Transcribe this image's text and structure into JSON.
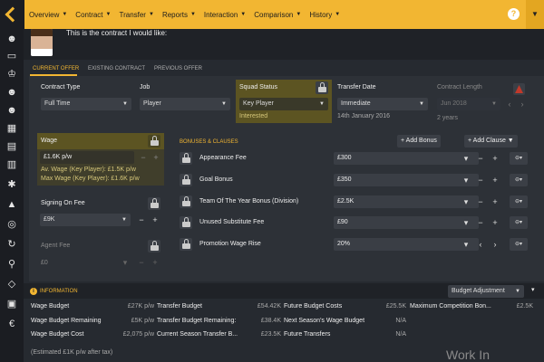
{
  "menu": [
    "Overview",
    "Contract",
    "Transfer",
    "Reports",
    "Interaction",
    "Comparison",
    "History"
  ],
  "header": {
    "quote": "This is the contract I would like:"
  },
  "tabs": [
    "CURRENT OFFER",
    "EXISTING CONTRACT",
    "PREVIOUS OFFER"
  ],
  "contract": {
    "contract_type_label": "Contract Type",
    "contract_type_value": "Full Time",
    "job_label": "Job",
    "job_value": "Player",
    "squad_status_label": "Squad Status",
    "squad_status_value": "Key Player",
    "squad_status_note": "Interested",
    "transfer_date_label": "Transfer Date",
    "transfer_date_value": "Immediate",
    "transfer_date_note": "14th January 2016",
    "contract_length_label": "Contract Length",
    "contract_length_value": "Jun 2018",
    "contract_length_note": "2 years"
  },
  "wage": {
    "label": "Wage",
    "value": "£1.6K p/w",
    "av": "Av. Wage (Key Player): £1.5K p/w",
    "max": "Max Wage (Key Player): £1.6K p/w"
  },
  "signing": {
    "label": "Signing On Fee",
    "value": "£9K"
  },
  "agent": {
    "label": "Agent Fee",
    "value": "£0"
  },
  "bonuses": {
    "title": "BONUSES & CLAUSES",
    "add_bonus": "Add Bonus",
    "add_clause": "Add Clause",
    "rows": [
      {
        "name": "Appearance Fee",
        "value": "£300"
      },
      {
        "name": "Goal Bonus",
        "value": "£350"
      },
      {
        "name": "Team Of The Year Bonus (Division)",
        "value": "£2.5K"
      },
      {
        "name": "Unused Substitute Fee",
        "value": "£90"
      },
      {
        "name": "Promotion Wage Rise",
        "value": "20%"
      }
    ]
  },
  "information": {
    "title": "INFORMATION",
    "budget_adjustment": "Budget Adjustment",
    "rows": [
      [
        {
          "label": "Wage Budget",
          "value": "£27K p/w"
        },
        {
          "label": "Transfer Budget",
          "value": "£54.42K"
        },
        {
          "label": "Future Budget Costs",
          "value": "£25.5K"
        },
        {
          "label": "Maximum Competition Bon...",
          "value": "£2.5K"
        }
      ],
      [
        {
          "label": "Wage Budget Remaining",
          "value": "£5K p/w"
        },
        {
          "label": "Transfer Budget Remaining:",
          "value": "£38.4K"
        },
        {
          "label": "Next Season's Wage Budget",
          "value": "N/A"
        }
      ],
      [
        {
          "label": "Wage Budget Cost",
          "value": "£2,075 p/w"
        },
        {
          "label": "Current Season Transfer B...",
          "value": "£23.5K"
        },
        {
          "label": "Future Transfers",
          "value": "N/A"
        }
      ]
    ],
    "footnote": "(Estimated £1K p/w after tax)"
  },
  "watermark": "Work In"
}
